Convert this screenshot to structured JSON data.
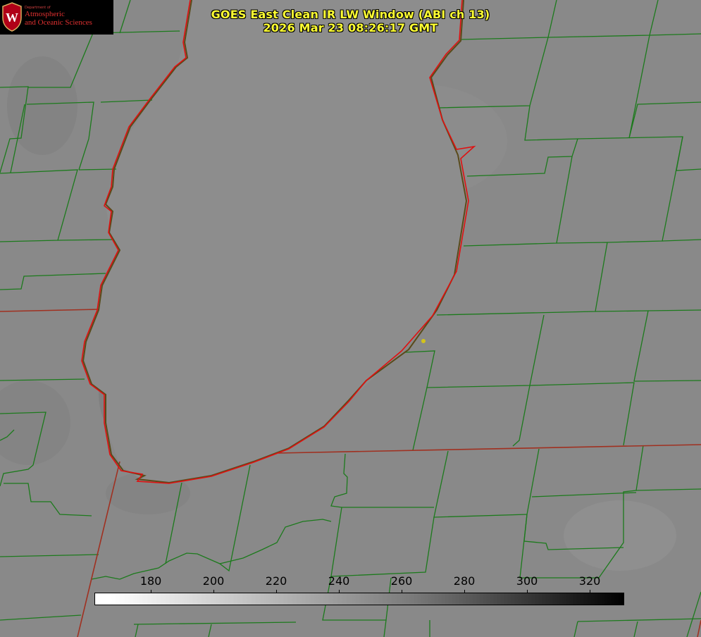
{
  "title": {
    "line1": "GOES East Clean IR LW Window (ABI ch 13)",
    "line2": "2026 Mar 23 08:26:17 GMT"
  },
  "logo": {
    "department_small": "Department of",
    "line1": "Atmospheric",
    "line2": "and Oceanic Sciences",
    "seal_letter": "W"
  },
  "colorbar": {
    "ticks": [
      "180",
      "200",
      "220",
      "240",
      "260",
      "280",
      "300",
      "320"
    ],
    "range": [
      162,
      331
    ],
    "colormap": "white-to-black grayscale"
  },
  "colors": {
    "background_gray": "#8a8a8a",
    "county_lines": "#1c7a1c",
    "state_lines": "#a03020",
    "lake_outline": "#e01010",
    "title_text": "#ffff33",
    "station_marker": "#d4c41a"
  }
}
